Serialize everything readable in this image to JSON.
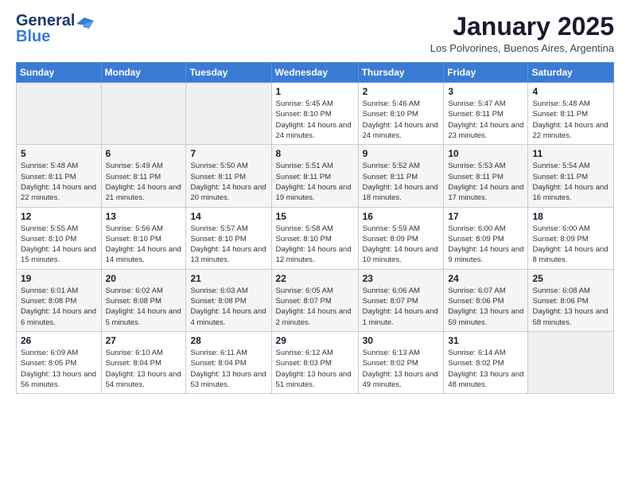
{
  "header": {
    "logo_line1": "General",
    "logo_line2": "Blue",
    "month_title": "January 2025",
    "location": "Los Polvorines, Buenos Aires, Argentina"
  },
  "weekdays": [
    "Sunday",
    "Monday",
    "Tuesday",
    "Wednesday",
    "Thursday",
    "Friday",
    "Saturday"
  ],
  "weeks": [
    [
      {
        "day": "",
        "info": ""
      },
      {
        "day": "",
        "info": ""
      },
      {
        "day": "",
        "info": ""
      },
      {
        "day": "1",
        "info": "Sunrise: 5:45 AM\nSunset: 8:10 PM\nDaylight: 14 hours\nand 24 minutes."
      },
      {
        "day": "2",
        "info": "Sunrise: 5:46 AM\nSunset: 8:10 PM\nDaylight: 14 hours\nand 24 minutes."
      },
      {
        "day": "3",
        "info": "Sunrise: 5:47 AM\nSunset: 8:11 PM\nDaylight: 14 hours\nand 23 minutes."
      },
      {
        "day": "4",
        "info": "Sunrise: 5:48 AM\nSunset: 8:11 PM\nDaylight: 14 hours\nand 22 minutes."
      }
    ],
    [
      {
        "day": "5",
        "info": "Sunrise: 5:48 AM\nSunset: 8:11 PM\nDaylight: 14 hours\nand 22 minutes."
      },
      {
        "day": "6",
        "info": "Sunrise: 5:49 AM\nSunset: 8:11 PM\nDaylight: 14 hours\nand 21 minutes."
      },
      {
        "day": "7",
        "info": "Sunrise: 5:50 AM\nSunset: 8:11 PM\nDaylight: 14 hours\nand 20 minutes."
      },
      {
        "day": "8",
        "info": "Sunrise: 5:51 AM\nSunset: 8:11 PM\nDaylight: 14 hours\nand 19 minutes."
      },
      {
        "day": "9",
        "info": "Sunrise: 5:52 AM\nSunset: 8:11 PM\nDaylight: 14 hours\nand 18 minutes."
      },
      {
        "day": "10",
        "info": "Sunrise: 5:53 AM\nSunset: 8:11 PM\nDaylight: 14 hours\nand 17 minutes."
      },
      {
        "day": "11",
        "info": "Sunrise: 5:54 AM\nSunset: 8:11 PM\nDaylight: 14 hours\nand 16 minutes."
      }
    ],
    [
      {
        "day": "12",
        "info": "Sunrise: 5:55 AM\nSunset: 8:10 PM\nDaylight: 14 hours\nand 15 minutes."
      },
      {
        "day": "13",
        "info": "Sunrise: 5:56 AM\nSunset: 8:10 PM\nDaylight: 14 hours\nand 14 minutes."
      },
      {
        "day": "14",
        "info": "Sunrise: 5:57 AM\nSunset: 8:10 PM\nDaylight: 14 hours\nand 13 minutes."
      },
      {
        "day": "15",
        "info": "Sunrise: 5:58 AM\nSunset: 8:10 PM\nDaylight: 14 hours\nand 12 minutes."
      },
      {
        "day": "16",
        "info": "Sunrise: 5:59 AM\nSunset: 8:09 PM\nDaylight: 14 hours\nand 10 minutes."
      },
      {
        "day": "17",
        "info": "Sunrise: 6:00 AM\nSunset: 8:09 PM\nDaylight: 14 hours\nand 9 minutes."
      },
      {
        "day": "18",
        "info": "Sunrise: 6:00 AM\nSunset: 8:09 PM\nDaylight: 14 hours\nand 8 minutes."
      }
    ],
    [
      {
        "day": "19",
        "info": "Sunrise: 6:01 AM\nSunset: 8:08 PM\nDaylight: 14 hours\nand 6 minutes."
      },
      {
        "day": "20",
        "info": "Sunrise: 6:02 AM\nSunset: 8:08 PM\nDaylight: 14 hours\nand 5 minutes."
      },
      {
        "day": "21",
        "info": "Sunrise: 6:03 AM\nSunset: 8:08 PM\nDaylight: 14 hours\nand 4 minutes."
      },
      {
        "day": "22",
        "info": "Sunrise: 6:05 AM\nSunset: 8:07 PM\nDaylight: 14 hours\nand 2 minutes."
      },
      {
        "day": "23",
        "info": "Sunrise: 6:06 AM\nSunset: 8:07 PM\nDaylight: 14 hours\nand 1 minute."
      },
      {
        "day": "24",
        "info": "Sunrise: 6:07 AM\nSunset: 8:06 PM\nDaylight: 13 hours\nand 59 minutes."
      },
      {
        "day": "25",
        "info": "Sunrise: 6:08 AM\nSunset: 8:06 PM\nDaylight: 13 hours\nand 58 minutes."
      }
    ],
    [
      {
        "day": "26",
        "info": "Sunrise: 6:09 AM\nSunset: 8:05 PM\nDaylight: 13 hours\nand 56 minutes."
      },
      {
        "day": "27",
        "info": "Sunrise: 6:10 AM\nSunset: 8:04 PM\nDaylight: 13 hours\nand 54 minutes."
      },
      {
        "day": "28",
        "info": "Sunrise: 6:11 AM\nSunset: 8:04 PM\nDaylight: 13 hours\nand 53 minutes."
      },
      {
        "day": "29",
        "info": "Sunrise: 6:12 AM\nSunset: 8:03 PM\nDaylight: 13 hours\nand 51 minutes."
      },
      {
        "day": "30",
        "info": "Sunrise: 6:13 AM\nSunset: 8:02 PM\nDaylight: 13 hours\nand 49 minutes."
      },
      {
        "day": "31",
        "info": "Sunrise: 6:14 AM\nSunset: 8:02 PM\nDaylight: 13 hours\nand 48 minutes."
      },
      {
        "day": "",
        "info": ""
      }
    ]
  ]
}
